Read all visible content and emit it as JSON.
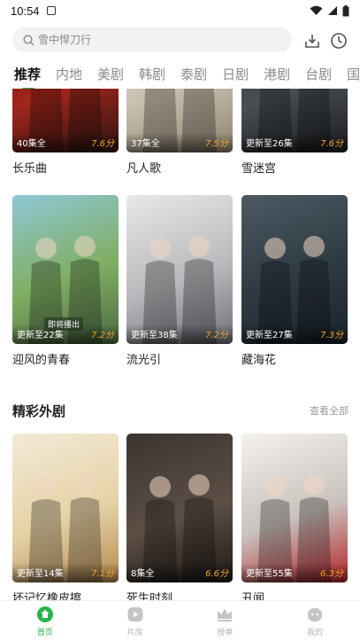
{
  "status": {
    "time": "10:54"
  },
  "search": {
    "placeholder": "雪中悍刀行"
  },
  "tabs": [
    "推荐",
    "内地",
    "美剧",
    "韩剧",
    "泰剧",
    "日剧",
    "港剧",
    "台剧",
    "国"
  ],
  "row1": [
    {
      "title": "长乐曲",
      "ep": "40集全",
      "score": "7.6分",
      "colors": [
        "#3a0d0a",
        "#a3261c",
        "#2a1410"
      ]
    },
    {
      "title": "凡人歌",
      "ep": "37集全",
      "score": "7.5分",
      "colors": [
        "#e9e4dc",
        "#c9bfae",
        "#8f8472"
      ]
    },
    {
      "title": "雪迷宫",
      "ep": "更新至26集",
      "score": "7.6分",
      "colors": [
        "#2b2f33",
        "#4a4f55",
        "#1a1c1f"
      ]
    }
  ],
  "row2": [
    {
      "title": "迎风的青春",
      "ep": "更新至22集",
      "score": "7.2分",
      "overlay": "即将播出",
      "colors": [
        "#8fc7d6",
        "#7fae62",
        "#4d6a45"
      ]
    },
    {
      "title": "流光引",
      "ep": "更新至38集",
      "score": "7.2分",
      "colors": [
        "#e8e8e6",
        "#b9babd",
        "#6f7278"
      ]
    },
    {
      "title": "藏海花",
      "ep": "更新至27集",
      "score": "7.3分",
      "colors": [
        "#4d5a63",
        "#2e3a42",
        "#1b2329"
      ]
    }
  ],
  "section": {
    "title": "精彩外剧",
    "see_all": "查看全部"
  },
  "row3": [
    {
      "title": "坏记忆橡皮擦",
      "ep": "更新至14集",
      "score": "7.1分",
      "colors": [
        "#f2ead8",
        "#e6d3a6",
        "#b58a52"
      ]
    },
    {
      "title": "死生时刻",
      "ep": "8集全",
      "score": "6.6分",
      "colors": [
        "#3a3430",
        "#5c4f46",
        "#1d1916"
      ]
    },
    {
      "title": "丑闻",
      "ep": "更新至55集",
      "score": "6.3分",
      "colors": [
        "#f4f1ee",
        "#c9c2bd",
        "#b3242a"
      ]
    }
  ],
  "nav": [
    {
      "label": "首页",
      "icon": "home-icon",
      "active": true
    },
    {
      "label": "片库",
      "icon": "play-library-icon",
      "active": false
    },
    {
      "label": "榜单",
      "icon": "crown-icon",
      "active": false
    },
    {
      "label": "我的",
      "icon": "profile-icon",
      "active": false
    }
  ],
  "accent": "#29b34b"
}
